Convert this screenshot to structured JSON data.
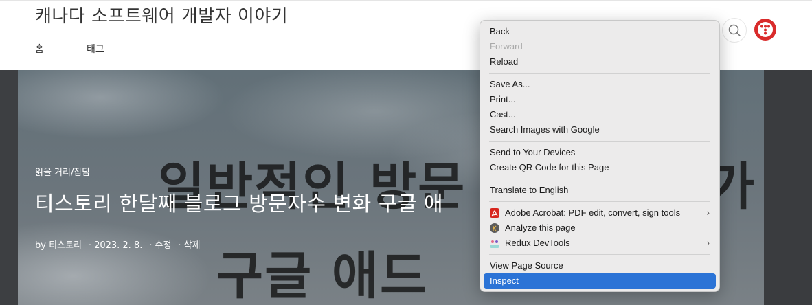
{
  "header": {
    "blog_title": "캐나다 소프트웨어 개발자 이야기",
    "nav": [
      "홈",
      "태그"
    ]
  },
  "hero": {
    "bg_text_line1": "일반적인 방문",
    "bg_text_line1_right": "가",
    "bg_text_line2": "구글 애드",
    "category": "읽을 거리/잡담",
    "title": "티스토리 한달째 블로그 방문자수 변화 구글 애",
    "meta": {
      "author": "by 티스토리",
      "date": "2023. 2. 8.",
      "edit": "수정",
      "delete": "삭제"
    }
  },
  "context_menu": {
    "groups": [
      [
        {
          "label": "Back",
          "disabled": false
        },
        {
          "label": "Forward",
          "disabled": true
        },
        {
          "label": "Reload",
          "disabled": false
        }
      ],
      [
        {
          "label": "Save As...",
          "disabled": false
        },
        {
          "label": "Print...",
          "disabled": false
        },
        {
          "label": "Cast...",
          "disabled": false
        },
        {
          "label": "Search Images with Google",
          "disabled": false
        }
      ],
      [
        {
          "label": "Send to Your Devices",
          "disabled": false
        },
        {
          "label": "Create QR Code for this Page",
          "disabled": false
        }
      ],
      [
        {
          "label": "Translate to English",
          "disabled": false
        }
      ],
      [
        {
          "label": "Adobe Acrobat: PDF edit, convert, sign tools",
          "icon": "adobe-acrobat-icon",
          "submenu": true
        },
        {
          "label": "Analyze this page",
          "icon": "analyzer-k-icon",
          "submenu": false
        },
        {
          "label": "Redux DevTools",
          "icon": "redux-devtools-icon",
          "submenu": true
        }
      ],
      [
        {
          "label": "View Page Source",
          "disabled": false
        },
        {
          "label": "Inspect",
          "disabled": false,
          "selected": true
        }
      ]
    ]
  },
  "colors": {
    "selection": "#2b73d6",
    "menu_bg": "#ecebeb",
    "avatar_red": "#d92b2b"
  }
}
